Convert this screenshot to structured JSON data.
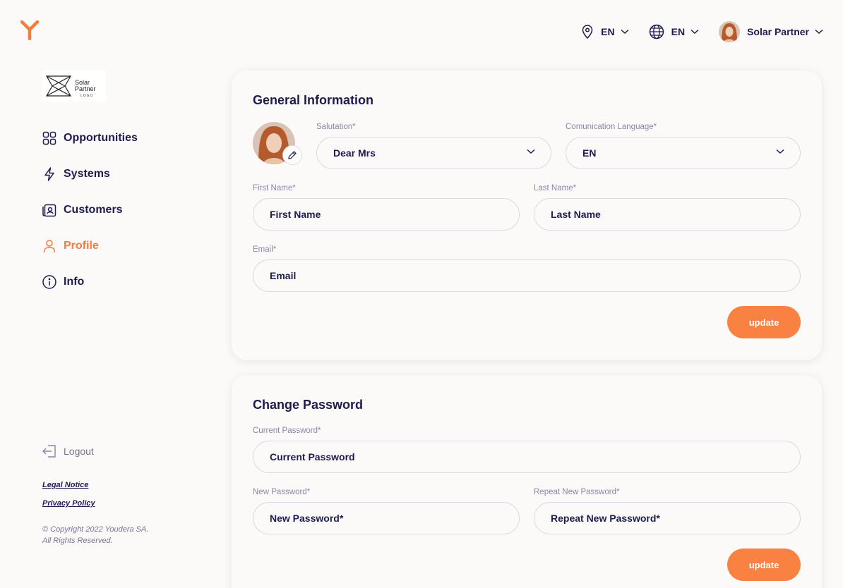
{
  "header": {
    "brand_icon": "youdera-y-logo",
    "location": {
      "icon": "map-pin-icon",
      "label": "EN"
    },
    "language": {
      "icon": "globe-icon",
      "label": "EN"
    },
    "user": {
      "name": "Solar Partner"
    }
  },
  "sidebar": {
    "partner_logo": {
      "line1": "Solar",
      "line2": "Partner",
      "sub": "LOGO"
    },
    "items": [
      {
        "label": "Opportunities",
        "icon": "grid-icon"
      },
      {
        "label": "Systems",
        "icon": "lightning-icon"
      },
      {
        "label": "Customers",
        "icon": "contact-card-icon"
      },
      {
        "label": "Profile",
        "icon": "user-icon",
        "active": true
      },
      {
        "label": "Info",
        "icon": "info-icon"
      }
    ],
    "logout": "Logout",
    "legal_notice": "Legal Notice",
    "privacy_policy": "Privacy Policy",
    "copyright_line1": "© Copyright 2022 Youdera SA.",
    "copyright_line2": "All Rights Reserved."
  },
  "general": {
    "title": "General Information",
    "salutation": {
      "label": "Salutation*",
      "value": "Dear Mrs"
    },
    "language": {
      "label": "Comunication Language*",
      "value": "EN"
    },
    "first_name": {
      "label": "First Name*",
      "value": "First Name"
    },
    "last_name": {
      "label": "Last Name*",
      "value": "Last Name"
    },
    "email": {
      "label": "Email*",
      "value": "Email"
    },
    "update": "update"
  },
  "password": {
    "title": "Change Password",
    "current": {
      "label": "Current Password*",
      "value": "Current Password"
    },
    "new": {
      "label": "New Password*",
      "value": "New Password*"
    },
    "repeat": {
      "label": "Repeat New Password*",
      "value": "Repeat New Password*"
    },
    "update": "update"
  },
  "colors": {
    "accent": "#f98141",
    "text": "#1f1b4d",
    "muted": "#8a86a8"
  }
}
